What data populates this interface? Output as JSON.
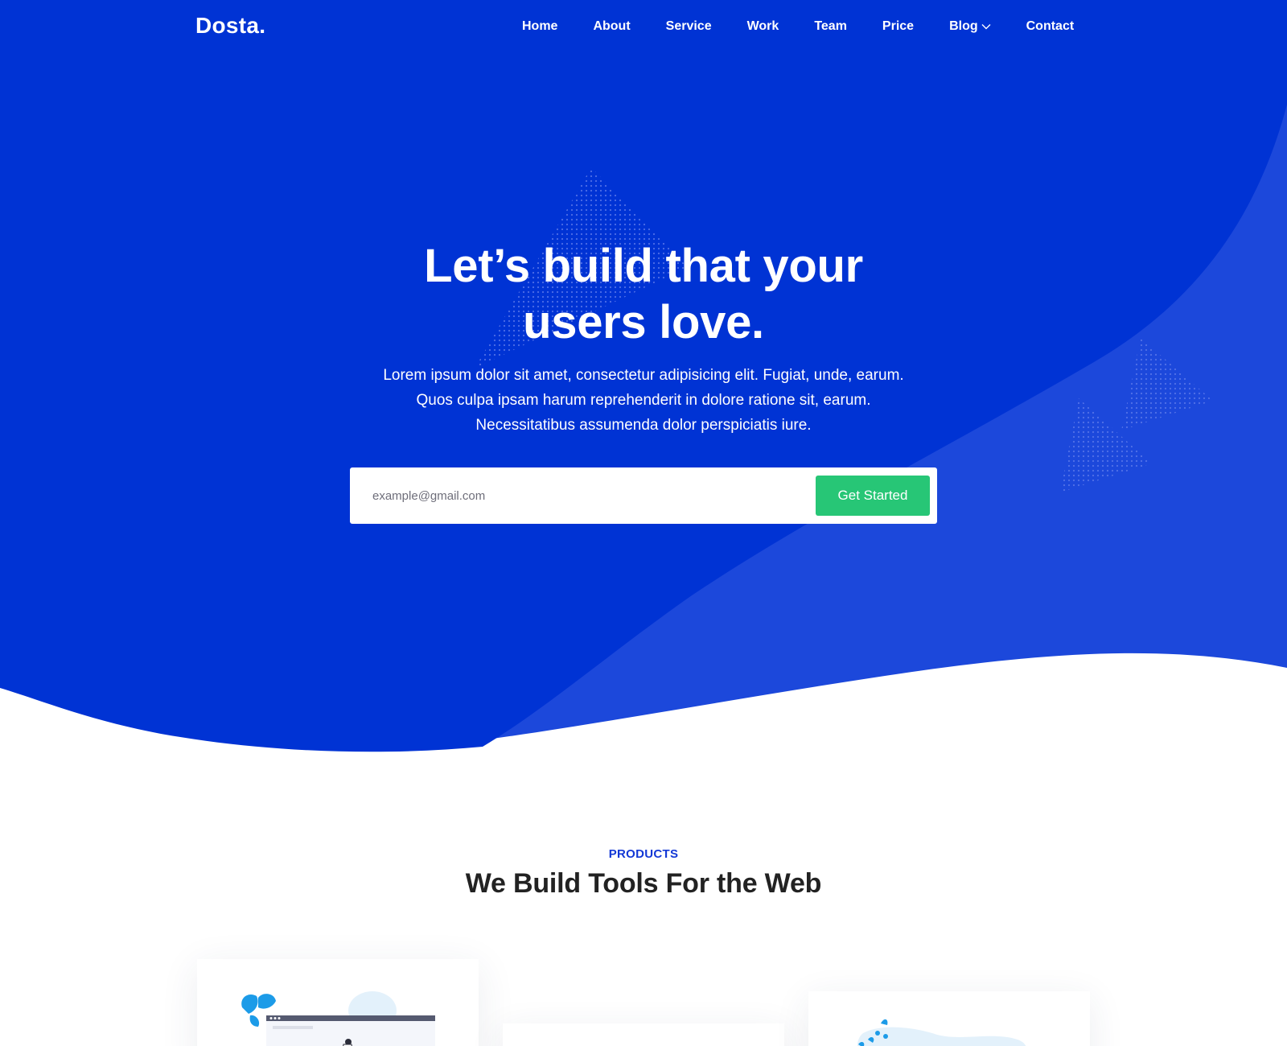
{
  "brand": {
    "name": "Dosta."
  },
  "nav": {
    "items": [
      {
        "label": "Home"
      },
      {
        "label": "About"
      },
      {
        "label": "Service"
      },
      {
        "label": "Work"
      },
      {
        "label": "Team"
      },
      {
        "label": "Price"
      },
      {
        "label": "Blog",
        "icon": "chevron-down-icon"
      },
      {
        "label": "Contact"
      }
    ]
  },
  "hero": {
    "title_line1": "Let’s build that your",
    "title_line2": "users love.",
    "description_line1": "Lorem ipsum dolor sit amet, consectetur adipisicing elit. Fugiat, unde, earum.",
    "description_line2": "Quos culpa ipsam harum reprehenderit in dolore ratione sit, earum.",
    "description_line3": "Necessitatibus assumenda dolor perspiciatis iure.",
    "email_placeholder": "example@gmail.com",
    "email_value": "",
    "cta_label": "Get Started"
  },
  "products": {
    "eyebrow": "PRODUCTS",
    "title": "We Build Tools For the Web"
  },
  "colors": {
    "hero_background": "#0033d4",
    "hero_wave_light": "#1c48db",
    "accent_blue": "#1338d6",
    "cta_green": "#27c676",
    "heading_dark": "#222222"
  }
}
